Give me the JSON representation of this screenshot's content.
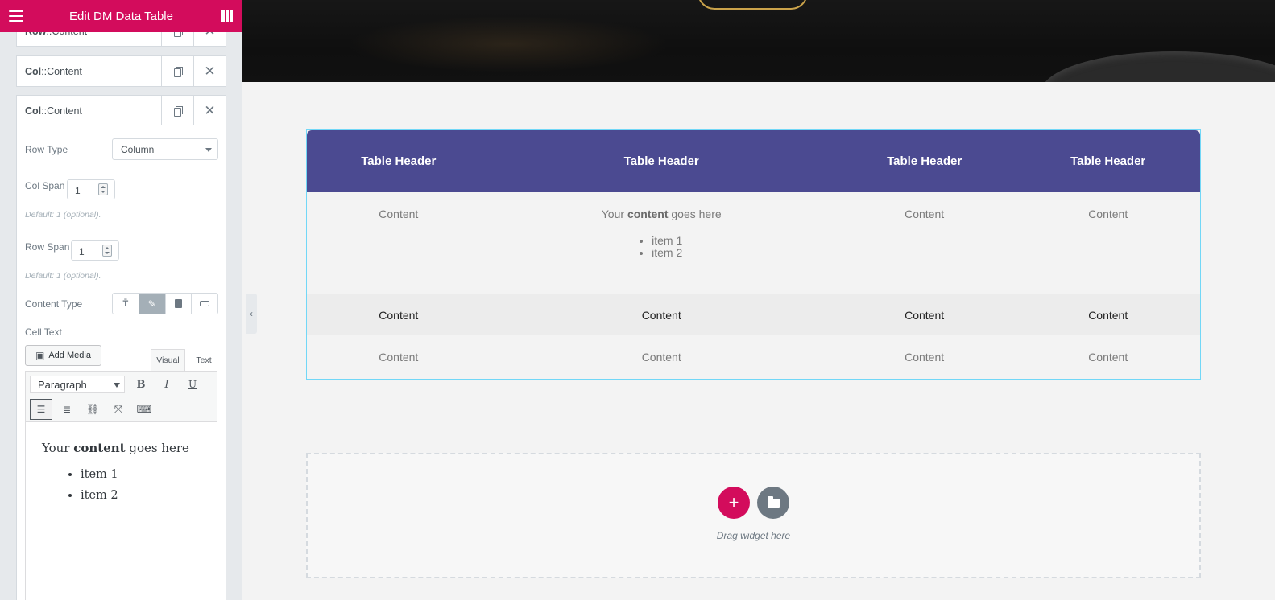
{
  "panel": {
    "title": "Edit DM Data Table",
    "items": [
      {
        "strong": "Row",
        "rest": "::Content"
      },
      {
        "strong": "Col",
        "rest": "::Content"
      },
      {
        "strong": "Col",
        "rest": "::Content"
      }
    ],
    "row_type": {
      "label": "Row Type",
      "value": "Column"
    },
    "col_span": {
      "label": "Col Span",
      "value": "1",
      "desc": "Default: 1 (optional)."
    },
    "row_span": {
      "label": "Row Span",
      "value": "1",
      "desc": "Default: 1 (optional)."
    },
    "content_type": {
      "label": "Content Type",
      "options": [
        "heading-icon",
        "edit-icon",
        "file-icon",
        "template-icon"
      ],
      "active": 1
    },
    "cell_text": {
      "label": "Cell Text",
      "add_media": "Add Media",
      "tab_visual": "Visual",
      "tab_text": "Text",
      "format": "Paragraph",
      "content_pre": "Your ",
      "content_bold": "content",
      "content_post": " goes here",
      "list": [
        "item 1",
        "item 2"
      ]
    }
  },
  "table": {
    "headers": [
      "Table Header",
      "Table Header",
      "Table Header",
      "Table Header"
    ],
    "row1": {
      "c1": "Content",
      "c2_pre": "Your ",
      "c2_bold": "content",
      "c2_post": " goes here",
      "c2_list": [
        "item 1",
        "item 2"
      ],
      "c3": "Content",
      "c4": "Content"
    },
    "row2": [
      "Content",
      "Content",
      "Content",
      "Content"
    ],
    "row3": [
      "Content",
      "Content",
      "Content",
      "Content"
    ]
  },
  "dropzone": {
    "text": "Drag widget here",
    "add_symbol": "+"
  },
  "colors": {
    "brand": "#d30c5c",
    "table_header": "#4b4a91",
    "selection": "#71d7f7"
  }
}
